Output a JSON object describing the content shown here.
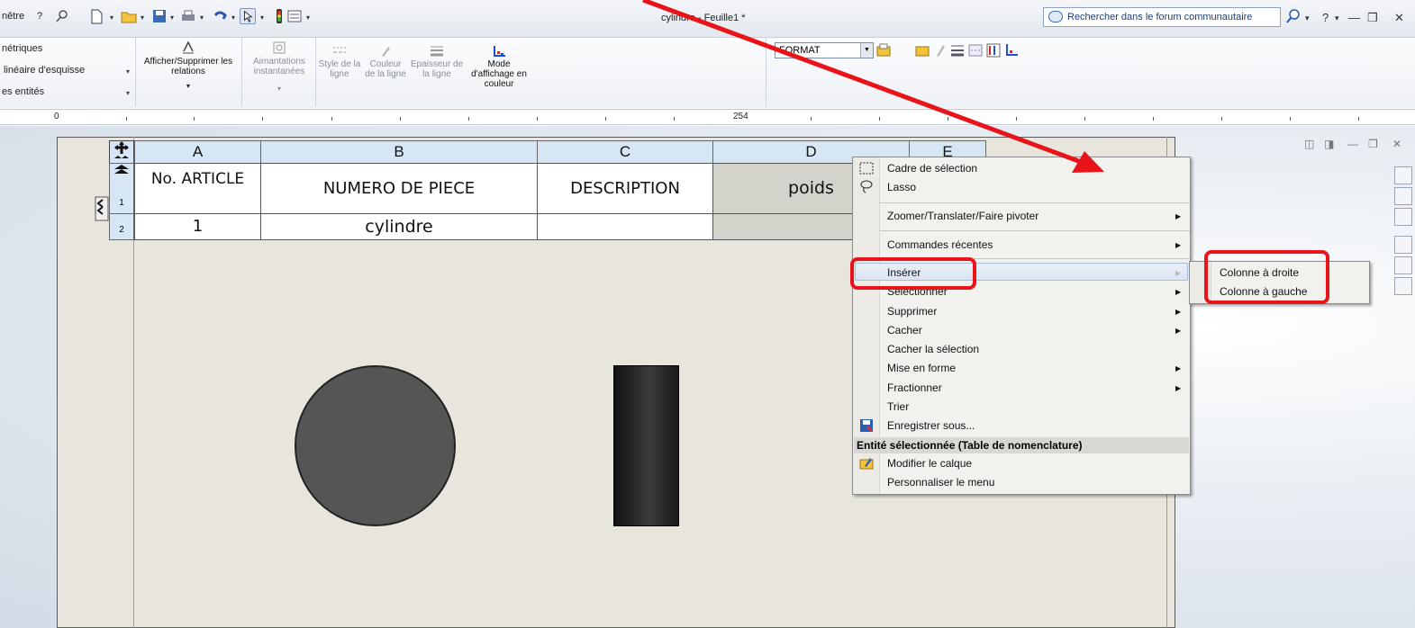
{
  "menu_bar": {
    "window_menu": "nêtre",
    "help_menu": "?"
  },
  "title": "cylindre - Feuille1 *",
  "search": {
    "placeholder": "Rechercher dans le forum communautaire"
  },
  "ribbon": {
    "left_items": [
      "nétriques",
      "linéaire d'esquisse",
      "es entités"
    ],
    "buttons": {
      "relations": "Afficher/Supprimer les relations",
      "aimantations": "Aimantations instantanées",
      "style_ligne": "Style de la ligne",
      "couleur_ligne": "Couleur de la ligne",
      "epaisseur_ligne": "Epaisseur de la ligne",
      "mode_affichage": "Mode d'affichage en couleur"
    },
    "format_value": "FORMAT"
  },
  "ruler": {
    "origin": "0",
    "mark": "254"
  },
  "bom_table": {
    "columns": [
      "A",
      "B",
      "C",
      "D",
      "E"
    ],
    "row_numbers": [
      "1",
      "2"
    ],
    "header": [
      "No. ARTICLE",
      "NUMERO DE PIECE",
      "DESCRIPTION",
      "poids"
    ],
    "rows": [
      [
        "1",
        "cylindre",
        "",
        ""
      ]
    ]
  },
  "context_menu": {
    "items": [
      {
        "label": "Cadre de sélection",
        "submenu": false,
        "icon": "selection-box-icon"
      },
      {
        "label": "Lasso",
        "submenu": false,
        "icon": "lasso-icon"
      },
      {
        "label": "Zoomer/Translater/Faire pivoter",
        "submenu": true
      },
      {
        "label": "Commandes récentes",
        "submenu": true
      },
      {
        "label": "Insérer",
        "submenu": true,
        "highlighted": true
      },
      {
        "label": "Sélectionner",
        "submenu": true
      },
      {
        "label": "Supprimer",
        "submenu": true
      },
      {
        "label": "Cacher",
        "submenu": true
      },
      {
        "label": "Cacher la sélection",
        "submenu": false
      },
      {
        "label": "Mise en forme",
        "submenu": true
      },
      {
        "label": "Fractionner",
        "submenu": true
      },
      {
        "label": "Trier",
        "submenu": false
      },
      {
        "label": "Enregistrer sous...",
        "submenu": false,
        "icon": "save-as-icon"
      }
    ],
    "section_title": "Entité sélectionnée (Table de nomenclature)",
    "section_items": [
      {
        "label": "Modifier le calque",
        "icon": "layer-icon"
      },
      {
        "label": "Personnaliser le menu"
      }
    ]
  },
  "insert_submenu": [
    "Colonne à droite",
    "Colonne à gauche"
  ],
  "colors": {
    "annotation_red": "#e8141a",
    "table_header_blue": "#d6e6f5",
    "menu_highlight": "#dbe5f3"
  }
}
